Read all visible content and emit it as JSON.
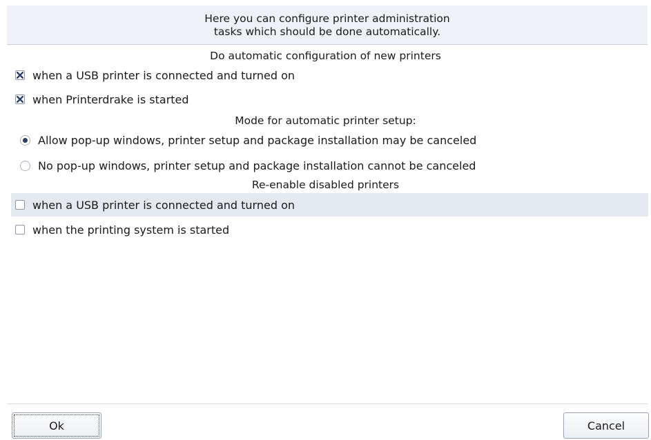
{
  "intro": {
    "line1": "Here you can configure printer administration",
    "line2": "tasks which should be done automatically."
  },
  "auto_config": {
    "title": "Do automatic configuration of new printers",
    "options": [
      {
        "label": "when a USB printer is connected and turned on",
        "checked": true
      },
      {
        "label": "when Printerdrake is started",
        "checked": true
      }
    ]
  },
  "setup_mode": {
    "title": "Mode for automatic printer setup:",
    "options": [
      {
        "label": "Allow pop-up windows, printer setup and package installation may be canceled",
        "selected": true
      },
      {
        "label": "No pop-up windows, printer setup and package installation cannot be canceled",
        "selected": false
      }
    ]
  },
  "reenable": {
    "title": "Re-enable disabled printers",
    "options": [
      {
        "label": "when a USB printer is connected and turned on",
        "checked": false
      },
      {
        "label": "when the printing system is started",
        "checked": false
      }
    ]
  },
  "buttons": {
    "ok": "Ok",
    "cancel": "Cancel"
  },
  "colors": {
    "check_mark": "#2b3f63",
    "radio_dot": "#2b3f63",
    "highlight_row": "#e4e8ef",
    "header_bg": "#eef1f6"
  }
}
